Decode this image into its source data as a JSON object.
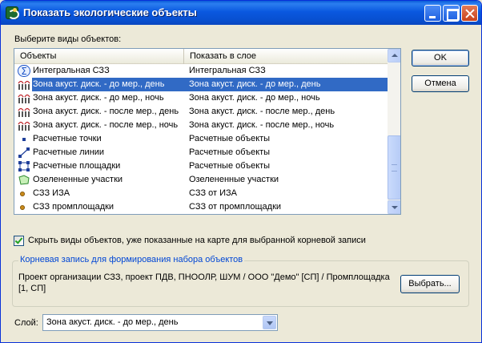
{
  "window": {
    "title": "Показать экологические объекты"
  },
  "list": {
    "label": "Выберите виды объектов:",
    "columns": [
      "Объекты",
      "Показать в слое"
    ],
    "rows": [
      {
        "icon": "sigma-icon",
        "object": "Интегральная СЗЗ",
        "layer": "Интегральная СЗЗ",
        "selected": false
      },
      {
        "icon": "noise-zone-icon",
        "object": "Зона акуст. диск. - до мер., день",
        "layer": "Зона акуст. диск. - до мер., день",
        "selected": true
      },
      {
        "icon": "noise-zone-icon",
        "object": "Зона акуст. диск. - до мер., ночь",
        "layer": "Зона акуст. диск. - до мер., ночь",
        "selected": false
      },
      {
        "icon": "noise-zone-icon",
        "object": "Зона акуст. диск. - после мер., день",
        "layer": "Зона акуст. диск. - после мер., день",
        "selected": false
      },
      {
        "icon": "noise-zone-icon",
        "object": "Зона акуст. диск. - после мер., ночь",
        "layer": "Зона акуст. диск. - после мер., ночь",
        "selected": false
      },
      {
        "icon": "point-icon",
        "object": "Расчетные точки",
        "layer": "Расчетные объекты",
        "selected": false
      },
      {
        "icon": "line-icon",
        "object": "Расчетные линии",
        "layer": "Расчетные объекты",
        "selected": false
      },
      {
        "icon": "area-icon",
        "object": "Расчетные площадки",
        "layer": "Расчетные объекты",
        "selected": false
      },
      {
        "icon": "green-area-icon",
        "object": "Озелененные участки",
        "layer": "Озелененные участки",
        "selected": false
      },
      {
        "icon": "dot-icon",
        "object": "СЗЗ ИЗА",
        "layer": "СЗЗ от ИЗА",
        "selected": false
      },
      {
        "icon": "dot-icon",
        "object": "СЗЗ промплощадки",
        "layer": "СЗЗ от промплощадки",
        "selected": false
      }
    ],
    "scroll": {
      "position": 0.55
    }
  },
  "buttons": {
    "ok": "OK",
    "cancel": "Отмена",
    "choose": "Выбрать..."
  },
  "hide_checkbox": {
    "label": "Скрыть виды объектов, уже показанные на карте для выбранной корневой записи",
    "checked": true
  },
  "root_group": {
    "title": "Корневая запись для формирования набора объектов",
    "path": "Проект организации СЗЗ, проект ПДВ, ПНООЛР, ШУМ / ООО \"Демо\" [СП] / Промплощадка [1, СП]"
  },
  "layer_select": {
    "label": "Слой:",
    "value": "Зона акуст. диск. - до мер., день"
  },
  "colors": {
    "selection": "#316ac5",
    "titlebar": "#0a58e0",
    "group_title": "#0046d5"
  }
}
